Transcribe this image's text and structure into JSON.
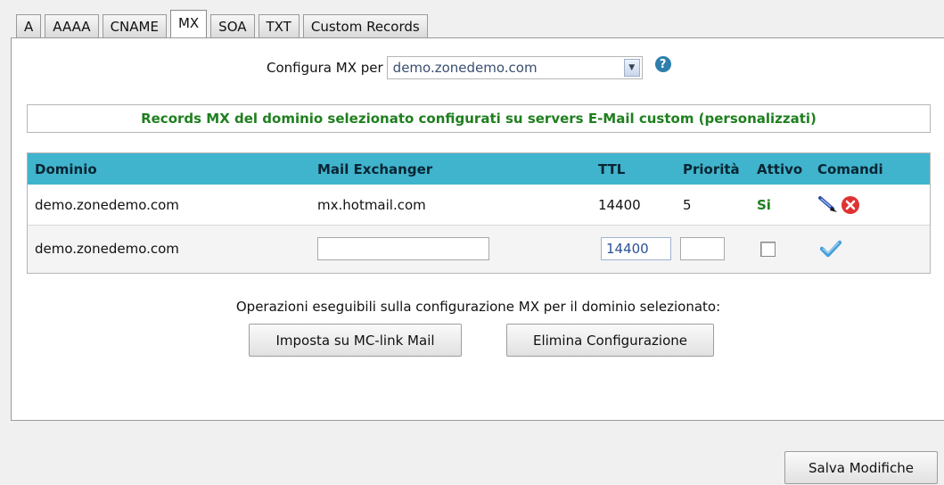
{
  "tabs": [
    {
      "label": "A"
    },
    {
      "label": "AAAA"
    },
    {
      "label": "CNAME"
    },
    {
      "label": "MX",
      "active": true
    },
    {
      "label": "SOA"
    },
    {
      "label": "TXT"
    },
    {
      "label": "Custom Records"
    }
  ],
  "config": {
    "label": "Configura MX per",
    "selected_domain": "demo.zonedemo.com",
    "help_glyph": "?"
  },
  "notice": "Records MX del dominio selezionato configurati su servers E-Mail custom (personalizzati)",
  "table": {
    "headers": [
      "Dominio",
      "Mail Exchanger",
      "TTL",
      "Priorità",
      "Attivo",
      "Comandi"
    ],
    "row": {
      "dominio": "demo.zonedemo.com",
      "mail_exchanger": "mx.hotmail.com",
      "ttl": "14400",
      "priorita": "5",
      "attivo": "Si"
    },
    "new_row": {
      "dominio": "demo.zonedemo.com",
      "mail_exchanger": "",
      "ttl": "14400",
      "priorita": "",
      "attivo_checked": false
    }
  },
  "operations": {
    "text": "Operazioni eseguibili sulla configurazione MX per il dominio selezionato:",
    "set_button": "Imposta su MC-link Mail",
    "delete_button": "Elimina Configurazione"
  },
  "save_button": "Salva Modifiche",
  "icons": {
    "edit": "pencil-icon",
    "delete": "delete-icon",
    "confirm": "checkmark-icon",
    "help": "help-icon"
  },
  "colors": {
    "header_bg": "#40b4cc",
    "notice_text": "#1f7f1f",
    "delete_icon": "#e03232",
    "confirm_icon": "#4aa0d8"
  }
}
